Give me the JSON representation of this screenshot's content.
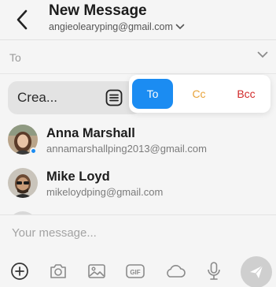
{
  "header": {
    "title": "New Message",
    "from_email": "angieolearyping@gmail.com"
  },
  "recipients": {
    "to_label": "To"
  },
  "create_group": {
    "label": "Crea..."
  },
  "recipient_type_options": [
    "To",
    "Cc",
    "Bcc"
  ],
  "contacts": [
    {
      "name": "Anna Marshall",
      "email": "annamarshallping2013@gmail.com"
    },
    {
      "name": "Mike Loyd",
      "email": "mikeloydping@gmail.com"
    }
  ],
  "compose": {
    "placeholder": "Your message..."
  },
  "toolbar": {
    "icons": [
      "add-icon",
      "camera-icon",
      "image-icon",
      "gif-icon",
      "cloud-icon",
      "microphone-icon",
      "send-icon"
    ]
  },
  "colors": {
    "accent": "#1b8cf2",
    "cc": "#e8a33a",
    "bcc": "#d12a2a",
    "background": "#f5f5f5"
  }
}
